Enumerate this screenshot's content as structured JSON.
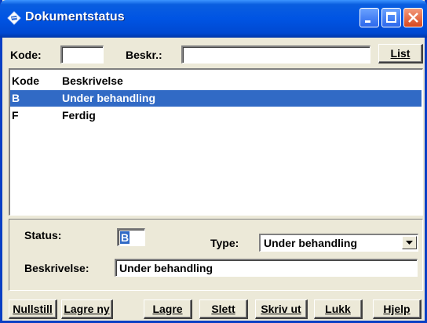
{
  "window": {
    "title": "Dokumentstatus"
  },
  "search": {
    "code_label": "Kode:",
    "code_value": "",
    "desc_label": "Beskr.:",
    "desc_value": "",
    "list_button": "List"
  },
  "list": {
    "headers": {
      "code": "Kode",
      "description": "Beskrivelse"
    },
    "rows": [
      {
        "code": "B",
        "description": "Under behandling",
        "selected": true
      },
      {
        "code": "F",
        "description": "Ferdig",
        "selected": false
      }
    ]
  },
  "detail": {
    "status_label": "Status:",
    "status_value": "B",
    "type_label": "Type:",
    "type_value": "Under behandling",
    "desc_label": "Beskrivelse:",
    "desc_value": "Under behandling"
  },
  "buttons": {
    "reset": "Nullstill",
    "save_new": "Lagre ny",
    "save": "Lagre",
    "delete": "Slett",
    "print": "Skriv ut",
    "close": "Lukk",
    "help": "Hjelp"
  },
  "colors": {
    "titlebar": "#0054e3",
    "selection": "#316ac5",
    "face": "#ece9d8"
  }
}
